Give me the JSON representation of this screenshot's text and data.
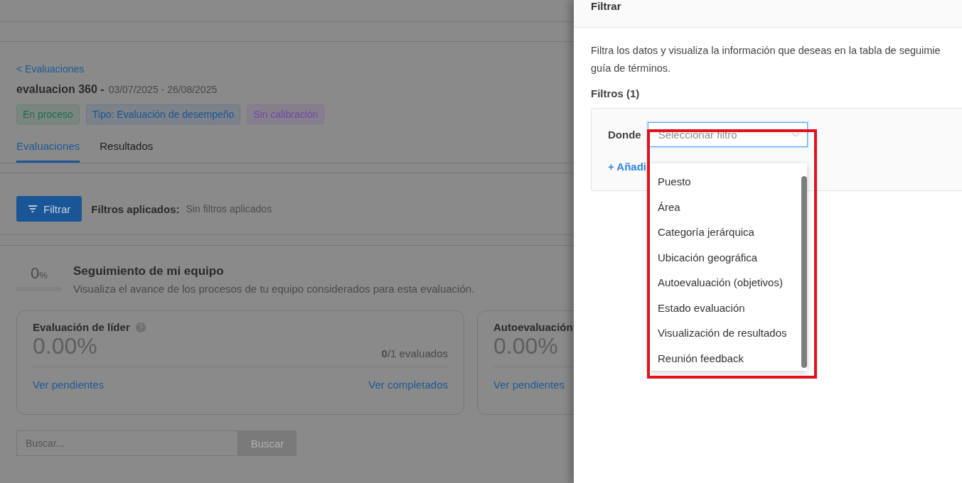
{
  "page": {
    "breadcrumb": "< Evaluaciones",
    "title": "evaluacion 360 -",
    "date_range": "03/07/2025 - 26/08/2025",
    "tags": [
      {
        "label": "En proceso",
        "color": "#1e6e4b"
      },
      {
        "label": "Tipo: Evaluación de desempeño",
        "color": "#1d5591"
      },
      {
        "label": "Sin calibración",
        "color": "#7047a3"
      }
    ],
    "tabs": [
      {
        "label": "Evaluaciones",
        "selected": true
      },
      {
        "label": "Resultados",
        "selected": false
      }
    ],
    "filter_button": "Filtrar",
    "applied_label": "Filtros aplicados:",
    "applied_value": "Sin filtros aplicados",
    "progress": {
      "value": "0",
      "unit": "%",
      "level": 0,
      "title": "Seguimiento de mi equipo",
      "description": "Visualiza el avance de los procesos de tu equipo considerados para esta evaluación."
    },
    "cards": [
      {
        "title": "Evaluación de líder",
        "help": true,
        "percent": "0.00%",
        "count_done": "0",
        "count_total": "/1 evaluados",
        "links": [
          "Ver pendientes",
          "Ver completados"
        ]
      },
      {
        "title": "Autoevaluación",
        "help": false,
        "percent": "0.00%",
        "links": [
          "Ver pendientes"
        ]
      }
    ],
    "search": {
      "placeholder": "Buscar...",
      "button": "Buscar"
    }
  },
  "drawer": {
    "title": "Filtrar",
    "description": "Filtra los datos y visualiza la información que deseas en la tabla de seguimie",
    "description_line2": "guía de términos.",
    "filters_label": "Filtros (1)",
    "row": {
      "label": "Donde",
      "placeholder": "Seleccionar filtro"
    },
    "add_link": "+ Añadi",
    "dropdown": {
      "options": [
        "Puesto",
        "Área",
        "Categoría jerárquica",
        "Ubicación geográfica",
        "Autoevaluación (objetivos)",
        "Estado evaluación",
        "Visualización de resultados",
        "Reunión feedback"
      ]
    }
  }
}
